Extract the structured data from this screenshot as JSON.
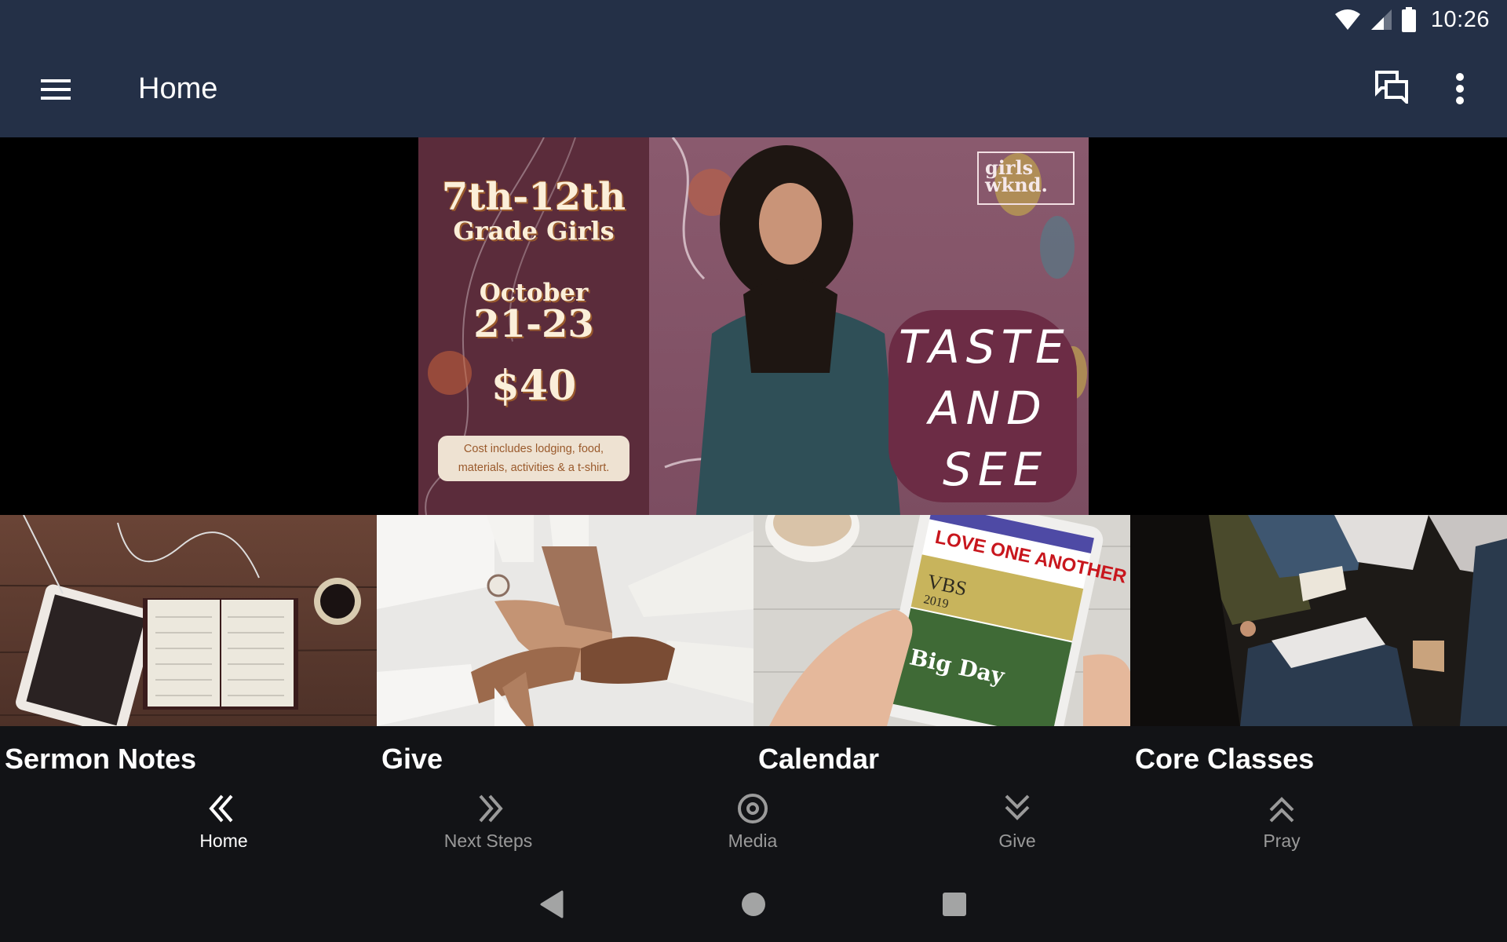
{
  "status_bar": {
    "time": "10:26",
    "icons": [
      "wifi-icon",
      "cell-signal-icon",
      "battery-icon"
    ]
  },
  "app_bar": {
    "title": "Home",
    "menu_icon": "hamburger-menu-icon",
    "actions": [
      {
        "name": "chat",
        "icon": "chat-bubbles-icon"
      },
      {
        "name": "more",
        "icon": "more-vertical-icon"
      }
    ]
  },
  "hero": {
    "grade_line1": "7th-12th",
    "grade_line2": "Grade Girls",
    "month": "October",
    "dates": "21-23",
    "price": "$40",
    "note": "Cost includes lodging, food, materials, activities & a t-shirt.",
    "tagline_lines": [
      "TASTE",
      "AND",
      "SEE"
    ],
    "logo_line1": "girls",
    "logo_line2": "wknd."
  },
  "tiles": [
    {
      "title": "Sermon Notes",
      "image": "bible-tablet-coffee-photo"
    },
    {
      "title": "Give",
      "image": "stacked-hands-photo"
    },
    {
      "title": "Calendar",
      "image": "tablet-events-photo"
    },
    {
      "title": "Core Classes",
      "image": "class-notebook-photo"
    }
  ],
  "bottom_nav": [
    {
      "label": "Home",
      "icon": "double-chevron-left-icon",
      "active": true
    },
    {
      "label": "Next Steps",
      "icon": "double-chevron-right-icon",
      "active": false
    },
    {
      "label": "Media",
      "icon": "target-circle-icon",
      "active": false
    },
    {
      "label": "Give",
      "icon": "double-chevron-down-icon",
      "active": false
    },
    {
      "label": "Pray",
      "icon": "double-chevron-up-icon",
      "active": false
    }
  ],
  "system_nav": [
    "back",
    "home",
    "recents"
  ],
  "colors": {
    "app_bar": "#243047",
    "background": "#121316",
    "active_nav": "#ffffff",
    "inactive_nav": "#9a9a9a"
  }
}
